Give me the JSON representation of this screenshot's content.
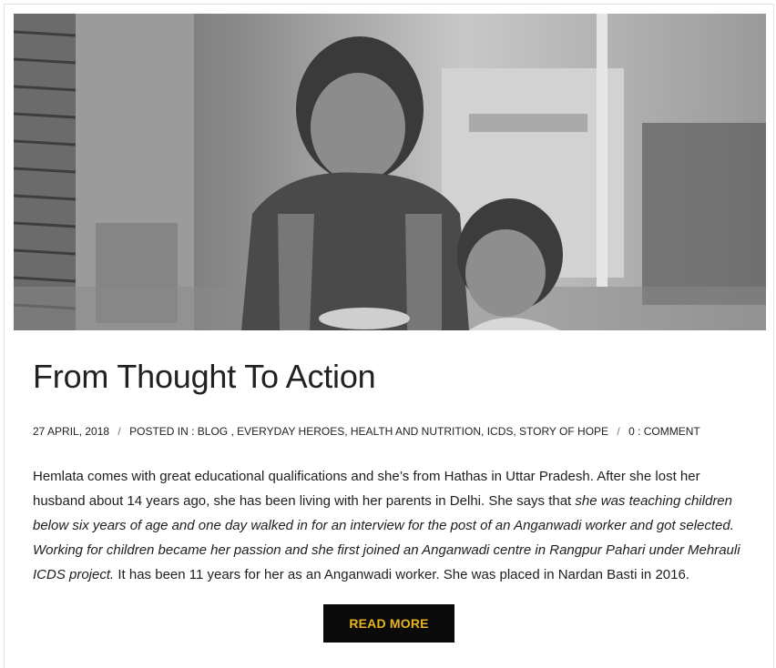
{
  "post": {
    "image_alt": "Two smiling children holding a metal bowl",
    "title": "From Thought To Action",
    "date": "27 APRIL, 2018",
    "posted_in_label": "POSTED IN :",
    "categories": [
      "BLOG",
      "EVERYDAY HEROES",
      "HEALTH AND NUTRITION",
      "ICDS",
      "STORY OF HOPE"
    ],
    "comments": "0 : COMMENT",
    "separator": "/",
    "excerpt_part1": "Hemlata comes with great educational qualifications and she’s from Hathas in Uttar Pradesh. After she lost her husband about 14 years ago, she has been living with her parents in Delhi. She says that ",
    "excerpt_italic": "she was teaching children below six years of age and one day walked in for an interview for the post of an Anganwadi worker and got selected. Working for children became her passion and she first joined an Anganwadi centre in Rangpur Pahari under Mehrauli ICDS project.",
    "excerpt_part2": " It has been 11 years for her as an Anganwadi worker. She was placed in Nardan Basti in 2016.",
    "read_more_label": "READ MORE"
  },
  "colors": {
    "button_bg": "#0a0a0a",
    "button_text": "#e8b31f",
    "text": "#222222"
  }
}
